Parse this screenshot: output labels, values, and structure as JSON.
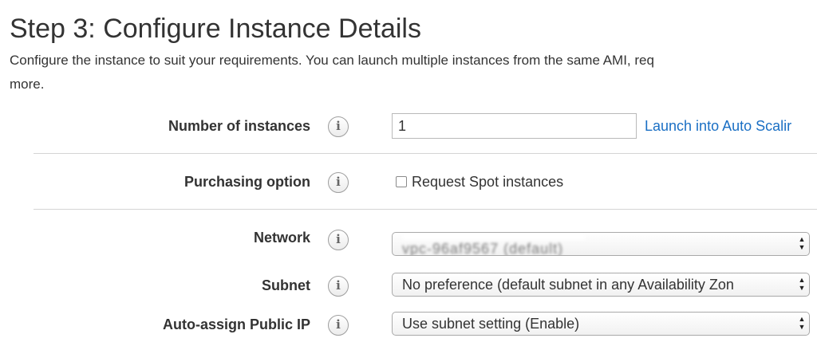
{
  "page": {
    "title": "Step 3: Configure Instance Details",
    "description_line1": "Configure the instance to suit your requirements. You can launch multiple instances from the same AMI, req",
    "description_line2": "more."
  },
  "form": {
    "number_of_instances": {
      "label": "Number of instances",
      "value": "1",
      "link": "Launch into Auto Scalir"
    },
    "purchasing_option": {
      "label": "Purchasing option",
      "checkbox_label": "Request Spot instances",
      "checked": false
    },
    "network": {
      "label": "Network",
      "value": "vpc-96af9567 (default)"
    },
    "subnet": {
      "label": "Subnet",
      "value": "No preference (default subnet in any Availability Zon"
    },
    "auto_assign_public_ip": {
      "label": "Auto-assign Public IP",
      "value": "Use subnet setting (Enable)"
    }
  },
  "icons": {
    "info": "info-icon",
    "select_arrows": "updown-arrows-icon"
  },
  "colors": {
    "link": "#1a6fc4",
    "divider": "#d5d5d5",
    "text": "#333333"
  }
}
